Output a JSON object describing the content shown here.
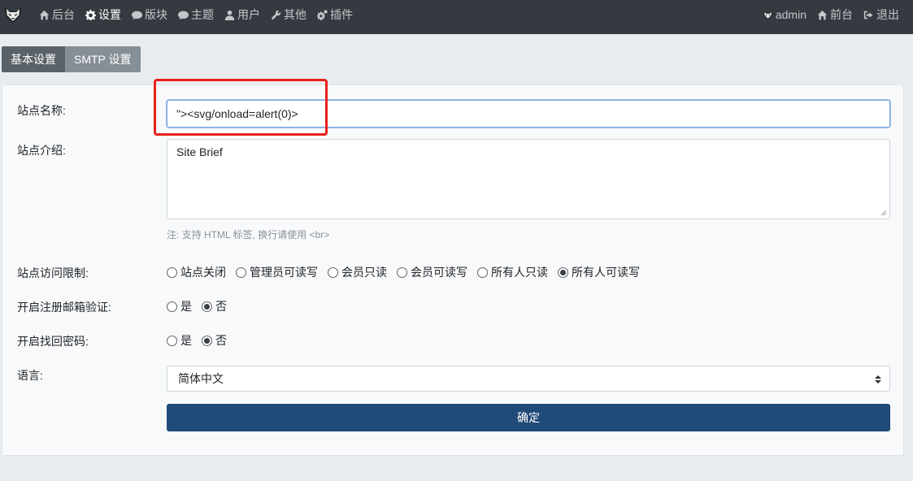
{
  "navbar": {
    "logo_icon": "fox-logo-icon",
    "left_items": [
      {
        "label": "后台",
        "icon": "home-icon",
        "active": false
      },
      {
        "label": "设置",
        "icon": "gear-icon",
        "active": true
      },
      {
        "label": "版块",
        "icon": "comment-icon",
        "active": false
      },
      {
        "label": "主题",
        "icon": "comment-icon",
        "active": false
      },
      {
        "label": "用户",
        "icon": "user-icon",
        "active": false
      },
      {
        "label": "其他",
        "icon": "wrench-icon",
        "active": false
      },
      {
        "label": "插件",
        "icon": "cogs-icon",
        "active": false
      }
    ],
    "right_items": [
      {
        "label": "admin",
        "icon": "avatar-icon"
      },
      {
        "label": "前台",
        "icon": "home-icon"
      },
      {
        "label": "退出",
        "icon": "sign-out-icon"
      }
    ]
  },
  "tabs": [
    {
      "label": "基本设置",
      "active": true
    },
    {
      "label": "SMTP 设置",
      "active": false
    }
  ],
  "form": {
    "site_name": {
      "label": "站点名称:",
      "value": "\"><svg/onload=alert(0)>"
    },
    "site_brief": {
      "label": "站点介绍:",
      "value": "Site Brief",
      "hint": "注: 支持 HTML 标签, 换行请使用 <br>"
    },
    "access": {
      "label": "站点访问限制:",
      "options": [
        "站点关闭",
        "管理员可读写",
        "会员只读",
        "会员可读写",
        "所有人只读",
        "所有人可读写"
      ],
      "selected": 5
    },
    "email_verify": {
      "label": "开启注册邮箱验证:",
      "options": [
        "是",
        "否"
      ],
      "selected": 1
    },
    "password_recovery": {
      "label": "开启找回密码:",
      "options": [
        "是",
        "否"
      ],
      "selected": 1
    },
    "language": {
      "label": "语言:",
      "value": "简体中文"
    },
    "submit_label": "确定"
  },
  "colors": {
    "navbar_bg": "#343a40",
    "primary_button": "#204a77",
    "highlight_box": "#e8201a",
    "page_bg": "#e9ecef"
  }
}
